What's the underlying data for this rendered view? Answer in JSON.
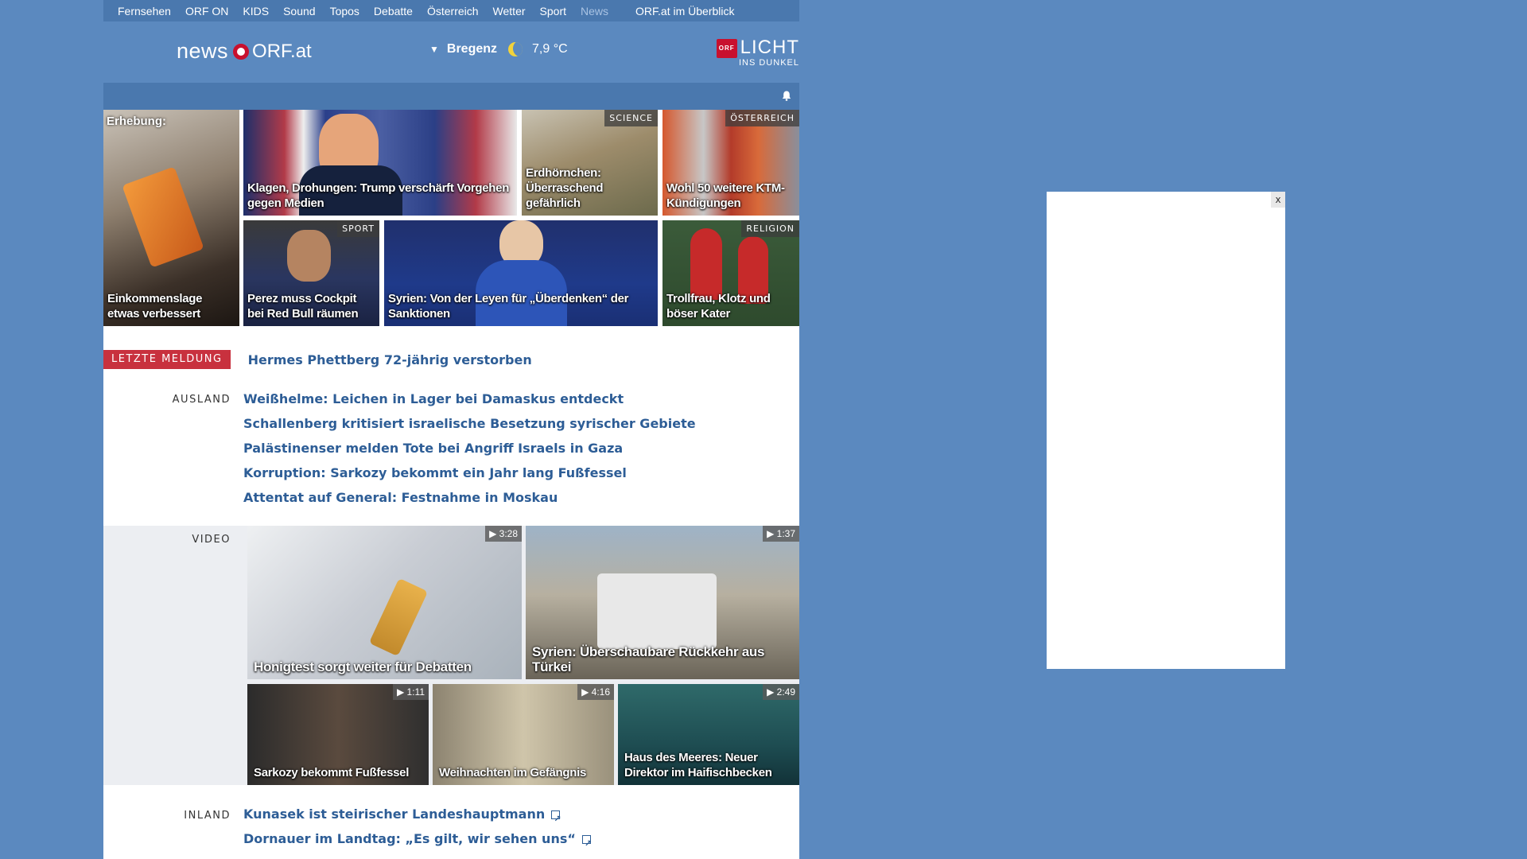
{
  "topnav": {
    "items": [
      "Fernsehen",
      "ORF ON",
      "KIDS",
      "Sound",
      "Topos",
      "Debatte",
      "Österreich",
      "Wetter",
      "Sport",
      "News"
    ],
    "overview": "ORF.at im Überblick"
  },
  "header": {
    "logo_news": "news",
    "logo_orf": "ORF.at",
    "weather_city": "Bregenz",
    "weather_temp": "7,9 °C",
    "campaign_badge": "ORF",
    "campaign_big": "LICHT",
    "campaign_small": "INS DUNKEL"
  },
  "tiles": [
    {
      "toplabel": "Erhebung:",
      "label": "Einkommenslage etwas verbessert",
      "tag": ""
    },
    {
      "label": "Klagen, Drohungen: Trump verschärft Vorgehen gegen Medien",
      "tag": ""
    },
    {
      "label": "Erdhörnchen: Überraschend gefährlich",
      "tag": "SCIENCE"
    },
    {
      "label": "Wohl 50 weitere KTM-Kündigungen",
      "tag": "ÖSTERREICH"
    },
    {
      "label": "Perez muss Cockpit bei Red Bull räumen",
      "tag": "SPORT"
    },
    {
      "label": "Syrien: Von der Leyen für „Überdenken“ der Sanktionen",
      "tag": ""
    },
    {
      "label": "Trollfrau, Klotz und böser Kater",
      "tag": "RELIGION"
    }
  ],
  "ticker": {
    "badge": "LETZTE MELDUNG",
    "headline": "Hermes Phettberg 72-jährig verstorben"
  },
  "ausland": {
    "label": "AUSLAND",
    "links": [
      "Weißhelme: Leichen in Lager bei Damaskus entdeckt",
      "Schallenberg kritisiert israelische Besetzung syrischer Gebiete",
      "Palästinenser melden Tote bei Angriff Israels in Gaza",
      "Korruption: Sarkozy bekommt ein Jahr lang Fußfessel",
      "Attentat auf General: Festnahme in Moskau"
    ]
  },
  "video": {
    "label": "VIDEO",
    "items": [
      {
        "label": "Honigtest sorgt weiter für Debatten",
        "duration": "▶ 3:28"
      },
      {
        "label": "Syrien: Überschaubare Rückkehr aus Türkei",
        "duration": "▶ 1:37"
      },
      {
        "label": "Sarkozy bekommt Fußfessel",
        "duration": "▶ 1:11"
      },
      {
        "label": "Weihnachten im Gefängnis",
        "duration": "▶ 4:16"
      },
      {
        "label": "Haus des Meeres: Neuer Direktor im Haifischbecken",
        "duration": "▶ 2:49"
      }
    ]
  },
  "inland": {
    "label": "INLAND",
    "links": [
      "Kunasek ist steirischer Landeshauptmann",
      "Dornauer im Landtag: „Es gilt, wir sehen uns“"
    ]
  },
  "ad": {
    "close": "x"
  }
}
